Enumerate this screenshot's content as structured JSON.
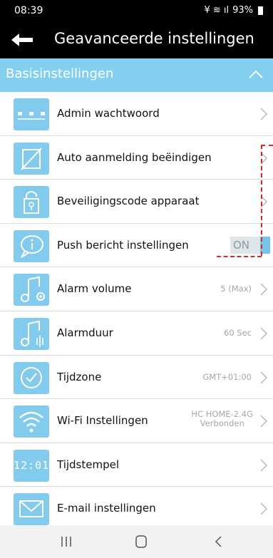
{
  "status": {
    "time": "08:39",
    "battery": "93%"
  },
  "header": {
    "title": "Geavanceerde instellingen"
  },
  "section": {
    "label": "Basisinstellingen"
  },
  "rows": [
    {
      "label": "Admin wachtwoord",
      "icon": "dots-icon"
    },
    {
      "label": "Auto aanmelding beëindigen",
      "icon": "auto-login-icon"
    },
    {
      "label": "Beveiligingscode apparaat",
      "icon": "lock-icon"
    },
    {
      "label": "Push bericht instellingen",
      "icon": "chat-info-icon",
      "toggle": "ON"
    },
    {
      "label": "Alarm volume",
      "icon": "music-settings-icon",
      "value": "5 (Max)"
    },
    {
      "label": "Alarmduur",
      "icon": "music-vibrate-icon",
      "value": "60 Sec"
    },
    {
      "label": "Tijdzone",
      "icon": "clock-check-icon",
      "value": "GMT+01:00"
    },
    {
      "label": "Wi-Fi Instellingen",
      "icon": "wifi-icon",
      "value_line1": "HC HOME-2.4G",
      "value_line2": "Verbonden"
    },
    {
      "label": "Tijdstempel",
      "icon": "digital-clock-icon",
      "icon_text": "12:01"
    },
    {
      "label": "E-mail instellingen",
      "icon": "mail-icon"
    }
  ],
  "colors": {
    "accent": "#82cff0",
    "icon_bg": "#83cbed",
    "highlight": "#d42a2a"
  }
}
